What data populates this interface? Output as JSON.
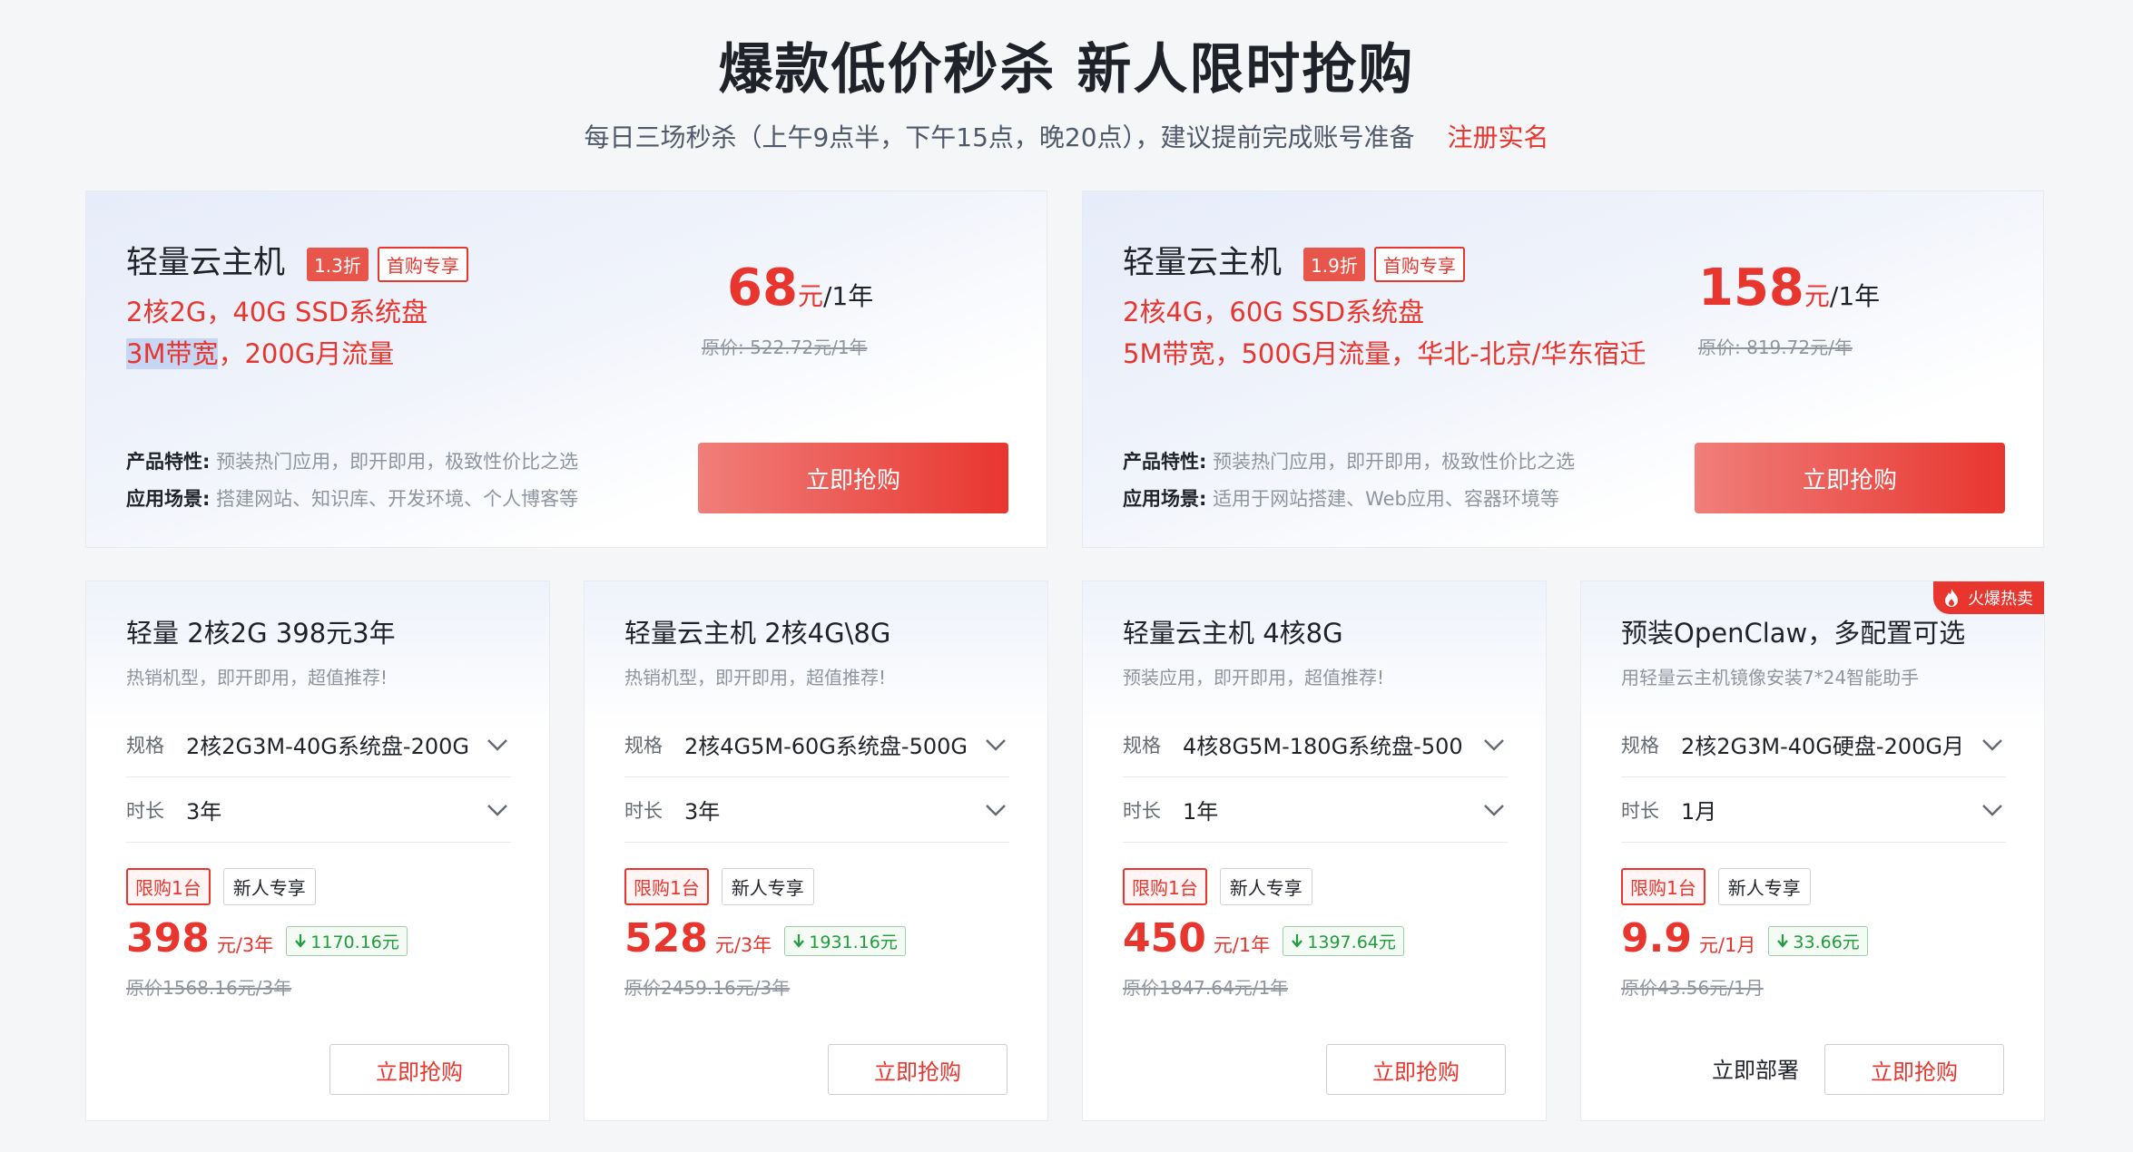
{
  "header": {
    "title": "爆款低价秒杀 新人限时抢购",
    "subtitle": "每日三场秒杀（上午9点半，下午15点，晚20点），建议提前完成账号准备",
    "register_link": "注册实名"
  },
  "featured": [
    {
      "title": "轻量云主机",
      "discount": "1.3折",
      "first_tag": "首购专享",
      "spec_line1": "2核2G，40G SSD系统盘",
      "spec_line2_highlight": "3M带宽",
      "spec_line2_rest": "，200G月流量",
      "price": "68",
      "price_unit": "元",
      "price_period": "/1年",
      "original": "原价: 522.72元/1年",
      "features_label": "产品特性:",
      "features": "预装热门应用，即开即用，极致性价比之选",
      "scenes_label": "应用场景:",
      "scenes": "搭建网站、知识库、开发环境、个人博客等",
      "button": "立即抢购"
    },
    {
      "title": "轻量云主机",
      "discount": "1.9折",
      "first_tag": "首购专享",
      "spec_line1": "2核4G，60G SSD系统盘",
      "spec_line2": "5M带宽，500G月流量，华北-北京/华东宿迁",
      "price": "158",
      "price_unit": "元",
      "price_period": "/1年",
      "original": "原价: 819.72元/年",
      "features_label": "产品特性:",
      "features": "预装热门应用，即开即用，极致性价比之选",
      "scenes_label": "应用场景:",
      "scenes": "适用于网站搭建、Web应用、容器环境等",
      "button": "立即抢购"
    }
  ],
  "products": [
    {
      "title": "轻量 2核2G 398元3年",
      "desc": "热销机型，即开即用，超值推荐!",
      "spec_label": "规格",
      "spec_value": "2核2G3M-40G系统盘-200G",
      "duration_label": "时长",
      "duration_value": "3年",
      "limit_badge": "限购1台",
      "new_badge": "新人专享",
      "price": "398",
      "price_period": "元/3年",
      "save": "1170.16元",
      "original": "原价1568.16元/3年",
      "button": "立即抢购"
    },
    {
      "title": "轻量云主机 2核4G\\8G",
      "desc": "热销机型，即开即用，超值推荐!",
      "spec_label": "规格",
      "spec_value": "2核4G5M-60G系统盘-500G",
      "duration_label": "时长",
      "duration_value": "3年",
      "limit_badge": "限购1台",
      "new_badge": "新人专享",
      "price": "528",
      "price_period": "元/3年",
      "save": "1931.16元",
      "original": "原价2459.16元/3年",
      "button": "立即抢购"
    },
    {
      "title": "轻量云主机 4核8G",
      "desc": "预装应用，即开即用，超值推荐!",
      "spec_label": "规格",
      "spec_value": "4核8G5M-180G系统盘-500",
      "duration_label": "时长",
      "duration_value": "1年",
      "limit_badge": "限购1台",
      "new_badge": "新人专享",
      "price": "450",
      "price_period": "元/1年",
      "save": "1397.64元",
      "original": "原价1847.64元/1年",
      "button": "立即抢购"
    },
    {
      "title": "预装OpenClaw，多配置可选",
      "desc": "用轻量云主机镜像安装7*24智能助手",
      "spec_label": "规格",
      "spec_value": "2核2G3M-40G硬盘-200G月",
      "duration_label": "时长",
      "duration_value": "1月",
      "limit_badge": "限购1台",
      "new_badge": "新人专享",
      "price": "9.9",
      "price_period": "元/1月",
      "save": "33.66元",
      "original": "原价43.56元/1月",
      "deploy": "立即部署",
      "button": "立即抢购",
      "hot_tag": "火爆热卖"
    }
  ],
  "colors": {
    "accent": "#e8362f",
    "save_green": "#1f9d3a",
    "muted": "#8f959e"
  }
}
